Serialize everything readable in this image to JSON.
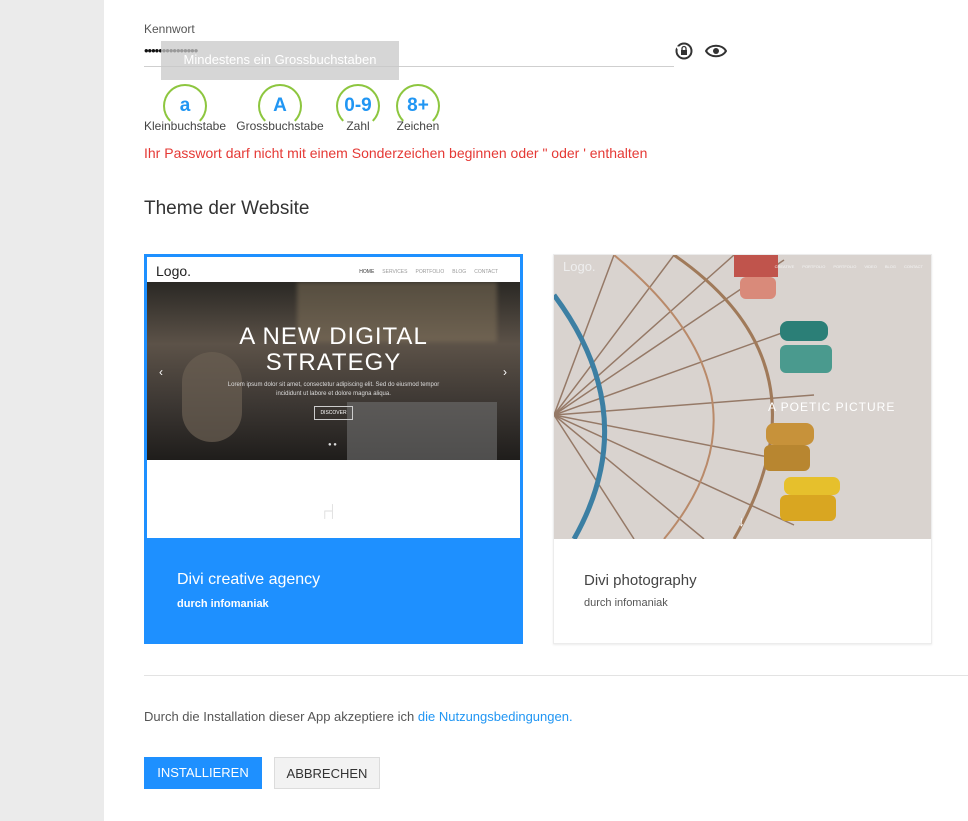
{
  "password": {
    "label": "Kennwort",
    "value": "•••••••••••••••",
    "tooltip": "Mindestens ein Grossbuchstaben",
    "icons": [
      "lock-reset-icon",
      "eye-icon"
    ]
  },
  "requirements": [
    {
      "symbol": "a",
      "label": "Kleinbuchstabe"
    },
    {
      "symbol": "A",
      "label": "Grossbuchstabe"
    },
    {
      "symbol": "0-9",
      "label": "Zahl"
    },
    {
      "symbol": "8+",
      "label": "Zeichen"
    }
  ],
  "error_message": "Ihr Passwort darf nicht mit einem Sonderzeichen beginnen oder \" oder ' enthalten",
  "theme_section": {
    "title": "Theme der Website",
    "themes": [
      {
        "name": "Divi creative agency",
        "author": "durch infomaniak",
        "selected": true,
        "preview": {
          "logo": "Logo.",
          "nav": [
            "HOME",
            "SERVICES",
            "PORTFOLIO",
            "BLOG",
            "CONTACT"
          ],
          "headline_line1": "A NEW DIGITAL",
          "headline_line2": "STRATEGY",
          "body": "Lorem ipsum dolor sit amet, consectetur adipiscing elit. Sed do eiusmod tempor incididunt ut labore et dolore magna aliqua.",
          "cta": "DISCOVER"
        }
      },
      {
        "name": "Divi photography",
        "author": "durch infomaniak",
        "selected": false,
        "preview": {
          "logo": "Logo.",
          "nav": [
            "CREATIVE",
            "PORTFOLIO",
            "PORTFOLIO",
            "VIDEO",
            "BLOG",
            "CONTACT"
          ],
          "tagline": "A POETIC PICTURE"
        }
      }
    ]
  },
  "terms": {
    "text": "Durch die Installation dieser App akzeptiere ich ",
    "link": "die Nutzungsbedingungen."
  },
  "buttons": {
    "install": "INSTALLIEREN",
    "cancel": "ABBRECHEN"
  },
  "colors": {
    "accent": "#1e90ff",
    "requirement_ok": "#8dc63f",
    "error": "#e53935"
  }
}
